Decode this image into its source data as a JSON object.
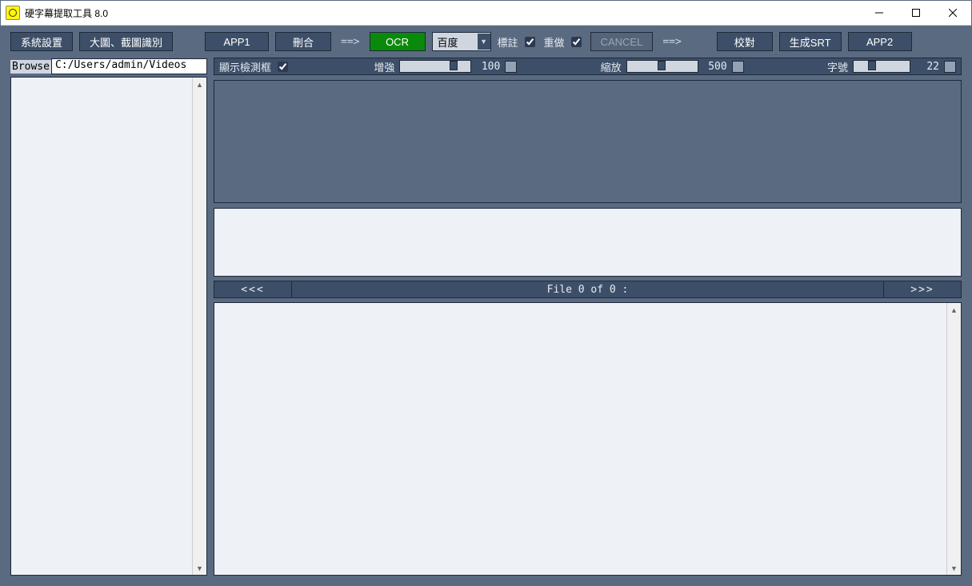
{
  "window": {
    "title": "硬字幕提取工具 8.0"
  },
  "toolbar": {
    "settings": "系統設置",
    "bigimg": "大圖、截圖識別",
    "app1": "APP1",
    "delmerge": "刪合",
    "arrow": "==>",
    "ocr": "OCR",
    "engine": "百度",
    "annotate": "標註",
    "redo": "重做",
    "cancel": "CANCEL",
    "proof": "校對",
    "gensrt": "生成SRT",
    "app2": "APP2"
  },
  "browse": {
    "label": "Browse",
    "path": "C:/Users/admin/Videos"
  },
  "controls": {
    "showbox": "顯示檢測框",
    "enhance": "增強",
    "enhance_val": "100",
    "scale": "縮放",
    "scale_val": "500",
    "font": "字號",
    "font_val": "22"
  },
  "nav": {
    "prev": "<<<",
    "next": ">>>",
    "status": "File 0 of 0 :"
  }
}
